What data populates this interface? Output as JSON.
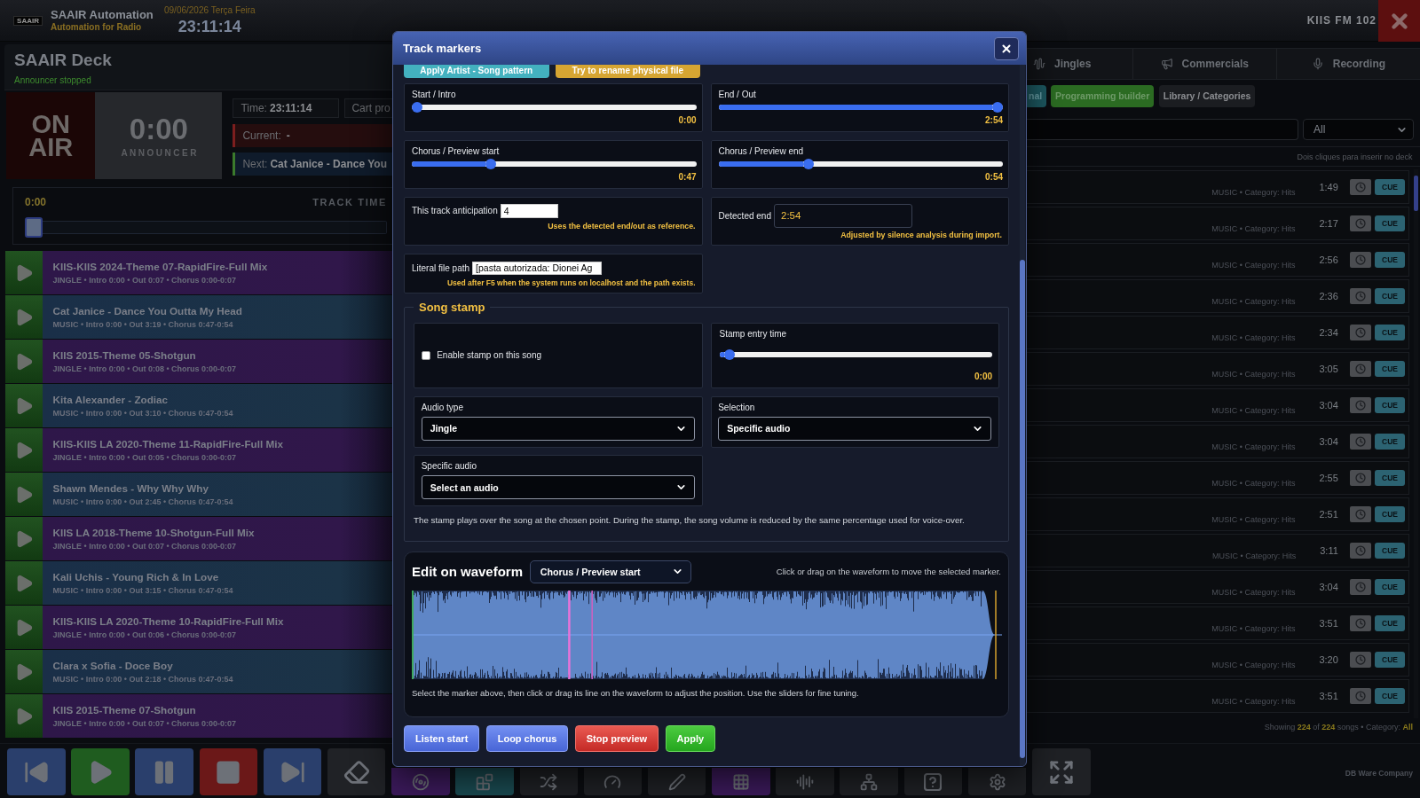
{
  "header": {
    "logo": "SAAIR",
    "app_title": "SAAIR Automation",
    "app_subtitle": "Automation for Radio",
    "date": "09/06/2026 Terça Feira",
    "clock": "23:11:14",
    "station": "KIIS FM 102"
  },
  "deck": {
    "title": "SAAIR Deck",
    "status": "Announcer stopped",
    "on_air": "ON AIR",
    "announcer_time": "0:00",
    "announcer_label": "ANNOUNCER",
    "time": {
      "label": "Time:",
      "value": "23:11:14"
    },
    "cart": {
      "label": "Cart pro"
    },
    "current": {
      "label": "Current:",
      "value": "-"
    },
    "next": {
      "label": "Next:",
      "value": "Cat Janice - Dance You"
    },
    "track_time": {
      "elapsed": "0:00",
      "label": "TRACK TIME",
      "level": 0
    }
  },
  "playlist": [
    {
      "kind": "jingle",
      "title": "KIIS-KIIS 2024-Theme 07-RapidFire-Full Mix",
      "details": "JINGLE • Intro 0:00 • Out 0:07 • Chorus 0:00-0:07"
    },
    {
      "kind": "music",
      "title": "Cat Janice - Dance You Outta My Head",
      "details": "MUSIC • Intro 0:00 • Out 3:19 • Chorus 0:47-0:54"
    },
    {
      "kind": "jingle",
      "title": "KIIS 2015-Theme 05-Shotgun",
      "details": "JINGLE • Intro 0:00 • Out 0:08 • Chorus 0:00-0:07"
    },
    {
      "kind": "music",
      "title": "Kita Alexander - Zodiac",
      "details": "MUSIC • Intro 0:00 • Out 3:10 • Chorus 0:47-0:54"
    },
    {
      "kind": "jingle",
      "title": "KIIS-KIIS LA 2020-Theme 11-RapidFire-Full Mix",
      "details": "JINGLE • Intro 0:00 • Out 0:05 • Chorus 0:00-0:07"
    },
    {
      "kind": "music",
      "title": "Shawn Mendes - Why Why Why",
      "details": "MUSIC • Intro 0:00 • Out 2:45 • Chorus 0:47-0:54"
    },
    {
      "kind": "jingle",
      "title": "KIIS LA 2018-Theme 10-Shotgun-Full Mix",
      "details": "JINGLE • Intro 0:00 • Out 0:07 • Chorus 0:00-0:07"
    },
    {
      "kind": "music",
      "title": "Kali Uchis - Young Rich & In Love",
      "details": "MUSIC • Intro 0:00 • Out 3:15 • Chorus 0:47-0:54"
    },
    {
      "kind": "jingle",
      "title": "KIIS-KIIS LA 2020-Theme 10-RapidFire-Full Mix",
      "details": "JINGLE • Intro 0:00 • Out 0:06 • Chorus 0:00-0:07"
    },
    {
      "kind": "music",
      "title": "Clara x Sofia - Doce Boy",
      "details": "MUSIC • Intro 0:00 • Out 2:18 • Chorus 0:47-0:54"
    },
    {
      "kind": "jingle",
      "title": "KIIS 2015-Theme 07-Shotgun",
      "details": "JINGLE • Intro 0:00 • Out 0:07 • Chorus 0:00-0:07"
    }
  ],
  "library": {
    "tabs": [
      {
        "kind": "jingles",
        "label": "Jingles",
        "selected": false
      },
      {
        "kind": "commercials",
        "label": "Commercials",
        "selected": false
      },
      {
        "kind": "recording",
        "label": "Recording",
        "selected": false
      }
    ],
    "buttons": [
      {
        "kind": "teal",
        "label": "nal"
      },
      {
        "kind": "green",
        "label": "Programming builder"
      },
      {
        "kind": "plain",
        "label": "Library / Categories"
      }
    ],
    "filter": {
      "value": "All"
    },
    "hint": "Dois cliques para inserir no deck",
    "rows": [
      {
        "meta": "MUSIC • Category: Hits",
        "duration": "1:49",
        "cue": "CUE"
      },
      {
        "meta": "MUSIC • Category: Hits",
        "duration": "2:17",
        "cue": "CUE"
      },
      {
        "meta": "MUSIC • Category: Hits",
        "duration": "2:56",
        "cue": "CUE"
      },
      {
        "meta": "MUSIC • Category: Hits",
        "duration": "2:36",
        "cue": "CUE"
      },
      {
        "meta": "MUSIC • Category: Hits",
        "duration": "2:34",
        "cue": "CUE"
      },
      {
        "meta": "MUSIC • Category: Hits",
        "duration": "3:05",
        "cue": "CUE"
      },
      {
        "meta": "MUSIC • Category: Hits",
        "duration": "3:04",
        "cue": "CUE"
      },
      {
        "meta": "MUSIC • Category: Hits",
        "duration": "3:04",
        "cue": "CUE"
      },
      {
        "meta": "MUSIC • Category: Hits",
        "duration": "2:55",
        "cue": "CUE"
      },
      {
        "meta": "MUSIC • Category: Hits",
        "duration": "2:51",
        "cue": "CUE"
      },
      {
        "meta": "MUSIC • Category: Hits",
        "duration": "3:11",
        "cue": "CUE"
      },
      {
        "meta": "MUSIC • Category: Hits",
        "duration": "3:04",
        "cue": "CUE"
      },
      {
        "meta": "MUSIC • Category: Hits",
        "duration": "3:51",
        "cue": "CUE"
      },
      {
        "meta": "MUSIC • Category: Hits",
        "duration": "3:20",
        "cue": "CUE"
      },
      {
        "meta": "MUSIC • Category: Hits",
        "duration": "3:51",
        "cue": "CUE"
      }
    ],
    "footer": "Showing **224** of **224** songs • Category: **All**"
  },
  "toolbar": {
    "buttons": [
      {
        "kind": "previous"
      },
      {
        "kind": "play"
      },
      {
        "kind": "pause"
      },
      {
        "kind": "stop"
      },
      {
        "kind": "next"
      },
      {
        "kind": "erase"
      },
      {
        "kind": "disc"
      },
      {
        "kind": "blocks"
      },
      {
        "kind": "shuffle"
      },
      {
        "kind": "dial"
      },
      {
        "kind": "pen"
      },
      {
        "kind": "grid"
      },
      {
        "kind": "levels"
      },
      {
        "kind": "network"
      },
      {
        "kind": "help"
      },
      {
        "kind": "settings"
      },
      {
        "kind": "fullscreen"
      }
    ],
    "company": "DB Ware Company"
  },
  "dialog": {
    "title": "Track markers",
    "top_actions": [
      {
        "kind": "teal",
        "label": "Apply Artist - Song pattern"
      },
      {
        "kind": "yellow",
        "label": "Try to rename physical file"
      }
    ],
    "markers": [
      {
        "label": "Start / Intro",
        "value": "0:00",
        "level": 0
      },
      {
        "label": "End / Out",
        "value": "2:54",
        "level": 1
      },
      {
        "label": "Chorus / Preview start",
        "value": "0:47",
        "level": 0.27
      },
      {
        "label": "Chorus / Preview end",
        "value": "0:54",
        "level": 0.31
      }
    ],
    "anticipation": {
      "label": "This track anticipation",
      "value": "4",
      "note": "Uses the detected end/out as reference."
    },
    "detected_end": {
      "label": "Detected end",
      "value": "2:54",
      "note": "Adjusted by silence analysis during import."
    },
    "file_path": {
      "label": "Literal file path",
      "value": "[pasta autorizada: Dionei Ag",
      "note": "Used after F5 when the system runs on localhost and the path exists."
    },
    "song_stamp": {
      "title": "Song stamp",
      "enable": {
        "label": "Enable stamp on this song",
        "checked": false
      },
      "entry_time": {
        "label": "Stamp entry time",
        "value": "0:00",
        "level": 0.02
      },
      "audio_type": {
        "label": "Audio type",
        "value": "Jingle"
      },
      "selection": {
        "label": "Selection",
        "value": "Specific audio"
      },
      "specific_audio": {
        "label": "Specific audio",
        "value": "Select an audio"
      },
      "note": "The stamp plays over the song at the chosen point. During the stamp, the song volume is reduced by the same percentage used for voice-over."
    },
    "waveform": {
      "title": "Edit on waveform",
      "marker_select": "Chorus / Preview start",
      "hint": "Click or drag on the waveform to move the selected marker.",
      "note": "Select the marker above, then click or drag its line on the waveform to adjust the position. Use the sliders for fine tuning."
    },
    "buttons": [
      {
        "kind": "primary",
        "label": "Listen start"
      },
      {
        "kind": "primary",
        "label": "Loop chorus"
      },
      {
        "kind": "danger",
        "label": "Stop preview"
      },
      {
        "kind": "success",
        "label": "Apply"
      }
    ]
  }
}
